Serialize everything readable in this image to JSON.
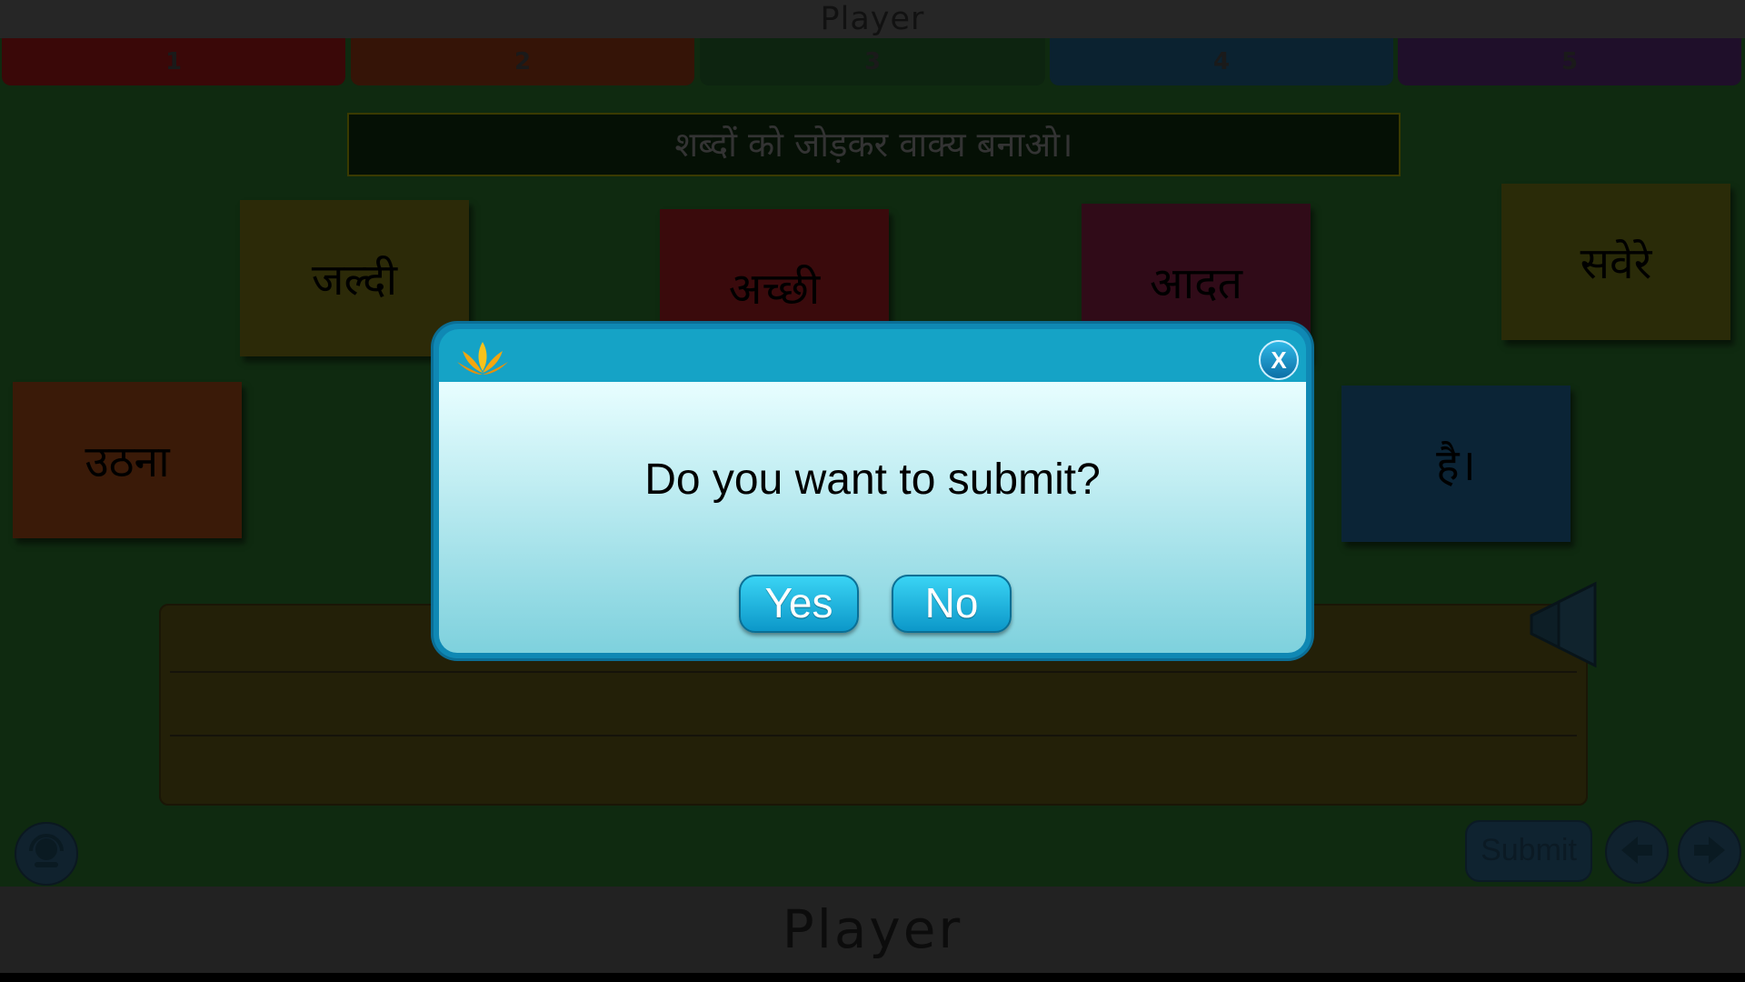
{
  "window": {
    "title": "Player",
    "footer_title": "Player"
  },
  "tabs": [
    {
      "label": "1",
      "color": "#3a0808"
    },
    {
      "label": "2",
      "color": "#351407"
    },
    {
      "label": "3",
      "color": "#0d2410"
    },
    {
      "label": "4",
      "color": "#0b2230"
    },
    {
      "label": "5",
      "color": "#1f0f2a"
    }
  ],
  "instruction": "शब्दों को जोड़कर वाक्य बनाओ।",
  "word_cards": [
    {
      "text": "जल्दी",
      "color": "#2c2a08"
    },
    {
      "text": "अच्छी",
      "color": "#3a0a0c"
    },
    {
      "text": "आदत",
      "color": "#300b18"
    },
    {
      "text": "सवेरे",
      "color": "#2a2b08"
    },
    {
      "text": "उठना",
      "color": "#3a1a08"
    },
    {
      "text": "है।",
      "color": "#0b2436"
    }
  ],
  "controls": {
    "submit_label": "Submit",
    "prev_icon": "arrow-left-icon",
    "next_icon": "arrow-right-icon",
    "help_icon": "headset-icon",
    "audio_icon": "speaker-icon"
  },
  "dialog": {
    "message": "Do you want to submit?",
    "yes_label": "Yes",
    "no_label": "No",
    "close_label": "X",
    "logo_icon": "lotus-icon",
    "accent": "#15a3c6"
  }
}
